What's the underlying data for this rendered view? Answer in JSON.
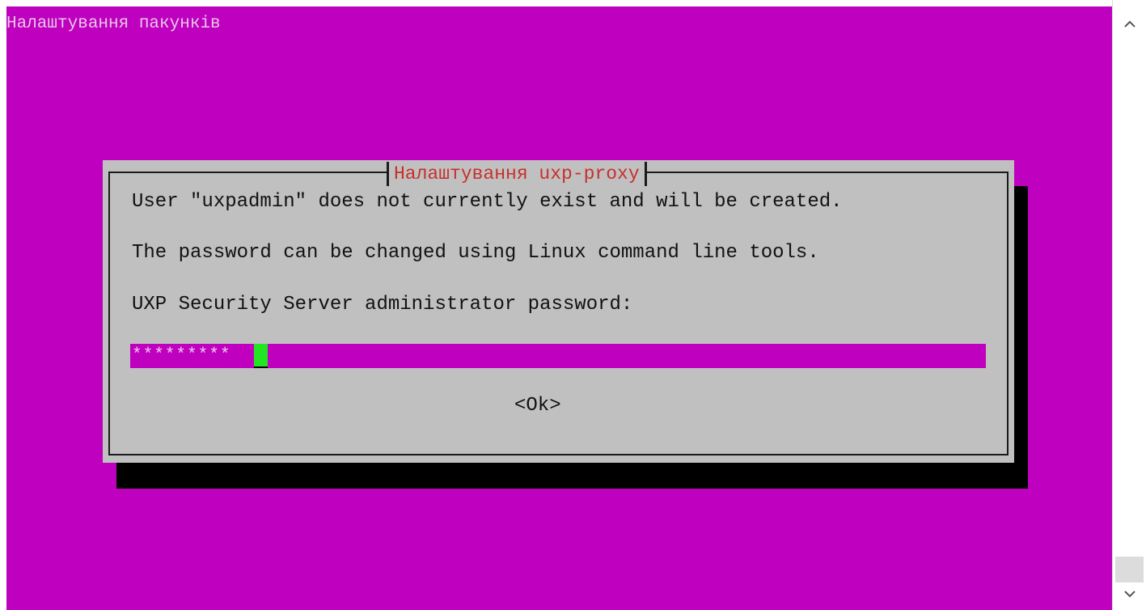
{
  "window": {
    "title": "Налаштування пакунків",
    "background_color": "#bf00bf"
  },
  "dialog": {
    "title": "Налаштування uxp-proxy",
    "line1": "User \"uxpadmin\" does not currently exist and will be created.",
    "line2": "The password can be changed using Linux command line tools.",
    "prompt": "UXP Security Server administrator password:",
    "password_mask": "*********",
    "ok_label": "<Ok>",
    "title_color": "#c8302c",
    "cursor_color": "#22e622"
  },
  "scrollbar": {
    "up_icon": "chevron-up-icon",
    "down_icon": "chevron-down-icon"
  }
}
